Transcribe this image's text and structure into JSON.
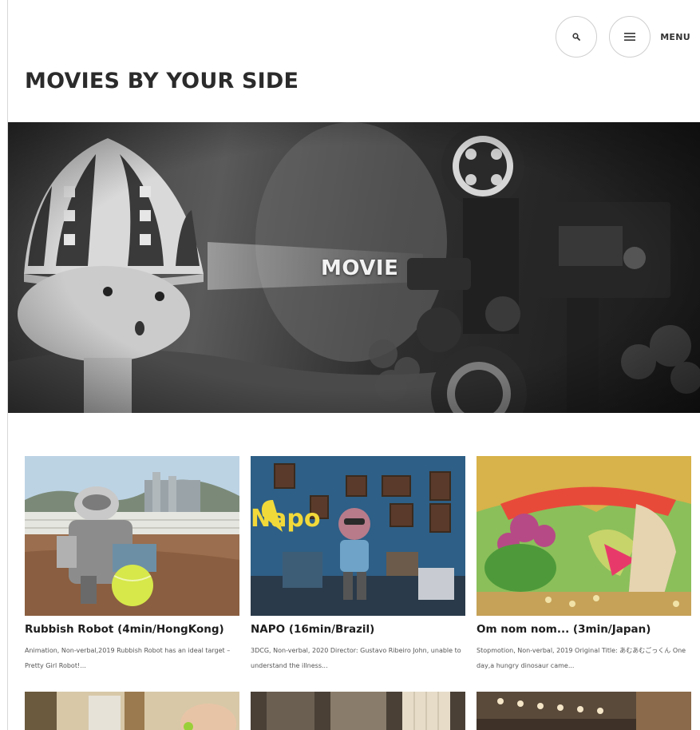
{
  "header": {
    "search_icon": "search-icon",
    "menu_icon": "hamburger-icon",
    "menu_label": "MENU"
  },
  "page": {
    "title": "MOVIES BY YOUR SIDE"
  },
  "hero": {
    "title": "MOVIE"
  },
  "cards": [
    {
      "title": "Rubbish Robot (4min/HongKong)",
      "description": "Animation, Non-verbal,2019 Rubbish Robot has an ideal target – Pretty Girl Robot!..."
    },
    {
      "title": "NAPO (16min/Brazil)",
      "description": "3DCG, Non-verbal, 2020 Director: Gustavo Ribeiro John, unable to understand the illness...",
      "poster_text": "Napo"
    },
    {
      "title": "Om nom nom... (3min/Japan)",
      "description": "Stopmotion, Non-verbal, 2019 Original Title: あむあむごっくん One day,a hungry dinosaur came..."
    }
  ],
  "colors": {
    "title": "#2b2b2b",
    "border": "#cfcfcf"
  }
}
